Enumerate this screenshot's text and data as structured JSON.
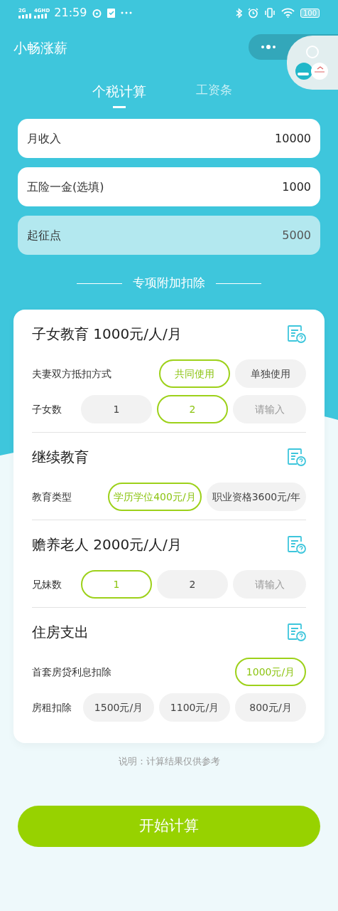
{
  "status_bar": {
    "signal_1": "2G",
    "signal_2": "4GHD",
    "time": "21:59",
    "battery": "100"
  },
  "app_title": "小畅涨薪",
  "tabs": [
    {
      "label": "个税计算",
      "selected": true
    },
    {
      "label": "工资条",
      "selected": false
    }
  ],
  "fields": [
    {
      "label": "月收入",
      "value": "10000",
      "kind": "input"
    },
    {
      "label": "五险一金(选填)",
      "value": "1000",
      "kind": "input"
    },
    {
      "label": "起征点",
      "value": "5000",
      "kind": "fixed"
    }
  ],
  "section_heading": "专项附加扣除",
  "sections": [
    {
      "title": "子女教育 1000元/人/月",
      "rows": [
        {
          "label": "夫妻双方抵扣方式",
          "options": [
            {
              "label": "共同使用",
              "selected": true,
              "kind": "option"
            },
            {
              "label": "单独使用",
              "selected": false,
              "kind": "option"
            }
          ]
        },
        {
          "label": "子女数",
          "options": [
            {
              "label": "1",
              "selected": false,
              "kind": "option"
            },
            {
              "label": "2",
              "selected": true,
              "kind": "option"
            },
            {
              "placeholder": "请输入",
              "kind": "input"
            }
          ]
        }
      ]
    },
    {
      "title": "继续教育",
      "rows": [
        {
          "label": "教育类型",
          "options": [
            {
              "label": "学历学位400元/月",
              "selected": true,
              "kind": "option"
            },
            {
              "label": "职业资格3600元/年",
              "selected": false,
              "kind": "option"
            }
          ]
        }
      ]
    },
    {
      "title": "赡养老人 2000元/人/月",
      "rows": [
        {
          "label": "兄妹数",
          "options": [
            {
              "label": "1",
              "selected": true,
              "kind": "option"
            },
            {
              "label": "2",
              "selected": false,
              "kind": "option"
            },
            {
              "placeholder": "请输入",
              "kind": "input"
            }
          ]
        }
      ]
    },
    {
      "title": "住房支出",
      "rows": [
        {
          "label": "首套房贷利息扣除",
          "options": [
            {
              "label": "1000元/月",
              "selected": true,
              "kind": "option"
            }
          ]
        },
        {
          "label": "房租扣除",
          "options": [
            {
              "label": "1500元/月",
              "selected": false,
              "kind": "option"
            },
            {
              "label": "1100元/月",
              "selected": false,
              "kind": "option"
            },
            {
              "label": "800元/月",
              "selected": false,
              "kind": "option"
            }
          ]
        }
      ]
    }
  ],
  "note": "说明：计算结果仅供参考",
  "submit_button": "开始计算"
}
